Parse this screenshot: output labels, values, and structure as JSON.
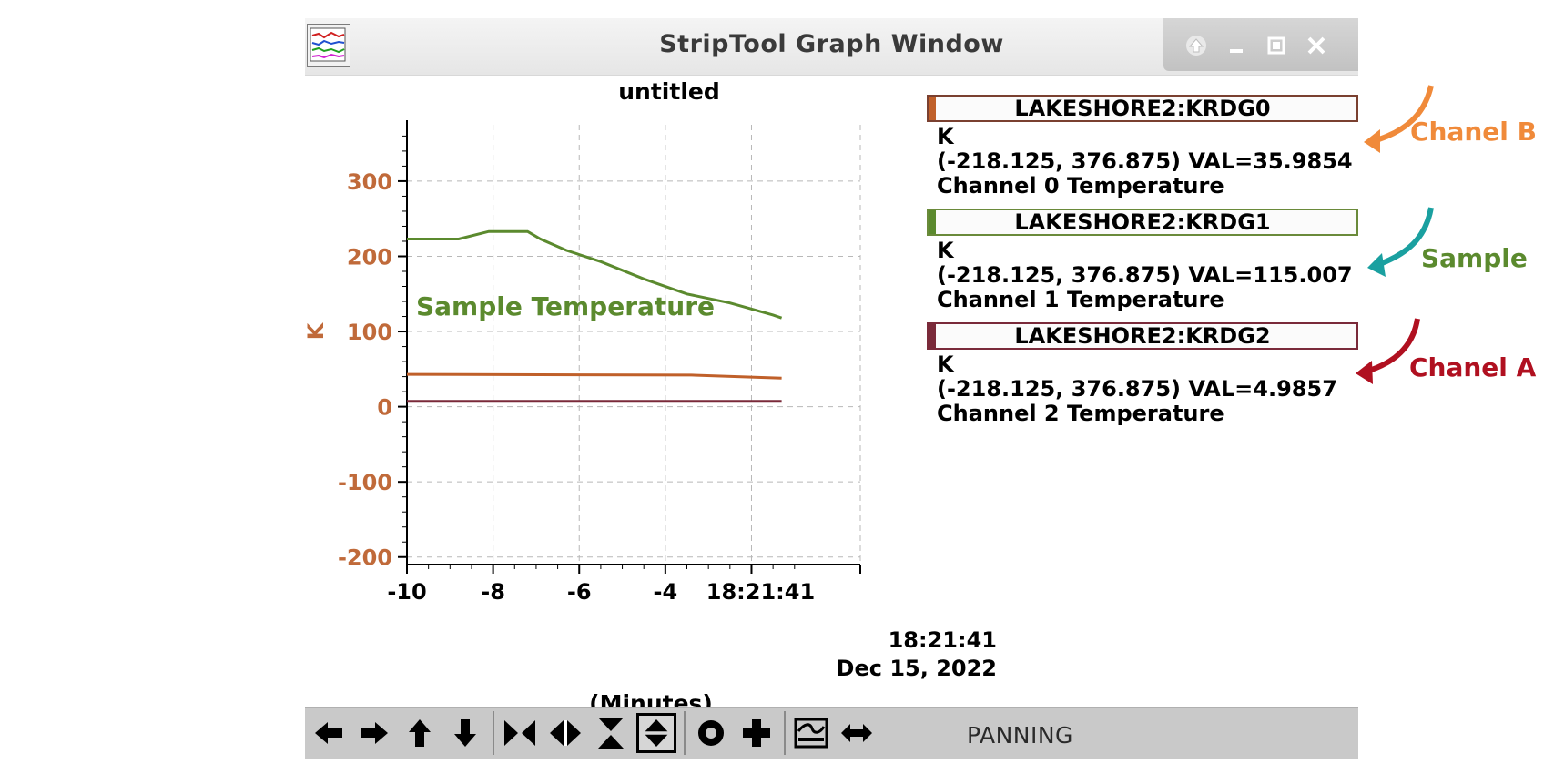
{
  "window": {
    "title": "StripTool Graph Window",
    "buttons": [
      "up-icon",
      "minimize-icon",
      "maximize-icon",
      "close-icon"
    ]
  },
  "graph": {
    "title": "untitled",
    "xlabel": "(Minutes)",
    "ylabel": "K",
    "time_label_line1": "18:21:41",
    "time_label_line2": "Dec 15, 2022",
    "annotation": "Sample Temperature"
  },
  "chart_data": {
    "type": "line",
    "title": "untitled",
    "xlabel": "(Minutes)",
    "ylabel": "K",
    "xlim": [
      -10,
      0
    ],
    "ylim": [
      -210,
      375
    ],
    "x_ticks": [
      "-10",
      "-8",
      "-6",
      "-4",
      "18:21:41"
    ],
    "y_ticks": [
      300,
      200,
      100,
      0,
      -100,
      -200
    ],
    "grid": true,
    "series": [
      {
        "name": "LAKESHORE2:KRDG1",
        "color": "#5b8a2e",
        "x": [
          -10,
          -8.8,
          -8.1,
          -7.2,
          -6.9,
          -6.3,
          -5.5,
          -4.5,
          -3.5,
          -2.5,
          -1.5,
          -1.3
        ],
        "y": [
          223,
          223,
          233,
          233,
          223,
          208,
          193,
          170,
          150,
          138,
          122,
          118
        ]
      },
      {
        "name": "LAKESHORE2:KRDG0",
        "color": "#c0602a",
        "x": [
          -10,
          -3.4,
          -1.3
        ],
        "y": [
          43,
          42,
          38
        ]
      },
      {
        "name": "LAKESHORE2:KRDG2",
        "color": "#7a2a3a",
        "x": [
          -10,
          -1.3
        ],
        "y": [
          7,
          7
        ]
      }
    ]
  },
  "legend": [
    {
      "name": "LAKESHORE2:KRDG0",
      "color": "#c0602a",
      "units": "K",
      "range_value": "(-218.125, 376.875) VAL=35.9854",
      "description": "Channel 0 Temperature"
    },
    {
      "name": "LAKESHORE2:KRDG1",
      "color": "#5b8a2e",
      "units": "K",
      "range_value": "(-218.125, 376.875) VAL=115.007",
      "description": "Channel 1 Temperature"
    },
    {
      "name": "LAKESHORE2:KRDG2",
      "color": "#7a2a3a",
      "units": "K",
      "range_value": "(-218.125, 376.875) VAL=4.9857",
      "description": "Channel 2 Temperature"
    }
  ],
  "toolbar": {
    "buttons": [
      {
        "name": "pan-left-icon",
        "glyph": "🡸"
      },
      {
        "name": "pan-right-icon",
        "glyph": "🡺"
      },
      {
        "name": "pan-up-icon",
        "glyph": "🡹"
      },
      {
        "name": "pan-down-icon",
        "glyph": "🡻"
      },
      {
        "name": "zoom-in-horizontal-icon",
        "glyph": "⋈"
      },
      {
        "name": "zoom-out-horizontal-icon",
        "glyph": "◆"
      },
      {
        "name": "zoom-in-vertical-icon",
        "glyph": "⧗"
      },
      {
        "name": "zoom-out-vertical-icon",
        "glyph": "⬍"
      },
      {
        "name": "refresh-icon",
        "glyph": "◉"
      },
      {
        "name": "add-icon",
        "glyph": "✚"
      },
      {
        "name": "autoscale-icon",
        "glyph": "≋"
      },
      {
        "name": "pan-mode-icon",
        "glyph": "⇔"
      }
    ],
    "mode": "PANNING"
  },
  "annotations": [
    {
      "label": "Chanel B",
      "color": "#f08a3a"
    },
    {
      "label": "Sample",
      "color": "#5b8a2e"
    },
    {
      "label": "Chanel A",
      "color": "#b01020"
    }
  ]
}
